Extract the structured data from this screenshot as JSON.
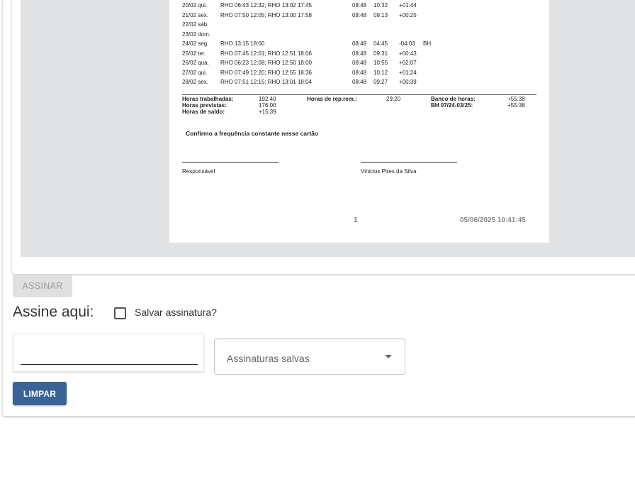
{
  "timesheet": {
    "rows": [
      {
        "date": "20/02 qui.",
        "marks": "RHO 06:43 12:32; RHO 13:02 17:45",
        "prev": "08:48",
        "work": "10:32",
        "diff": "+01:44",
        "note": ""
      },
      {
        "date": "21/02 sex.",
        "marks": "RHO 07:50 12:05; RHO 13:00 17:58",
        "prev": "08:48",
        "work": "09:13",
        "diff": "+00:25",
        "note": ""
      },
      {
        "date": "22/02 sáb.",
        "marks": "",
        "prev": "",
        "work": "",
        "diff": "",
        "note": ""
      },
      {
        "date": "23/02 dom.",
        "marks": "",
        "prev": "",
        "work": "",
        "diff": "",
        "note": ""
      },
      {
        "date": "24/02 seg.",
        "marks": "RHO 13:15 18:00",
        "prev": "08:48",
        "work": "04:45",
        "diff": "-04:03",
        "note": "BH"
      },
      {
        "date": "25/02 ter.",
        "marks": "RHO 07:45 12:01; RHO 12:51 18:06",
        "prev": "08:48",
        "work": "09:31",
        "diff": "+00:43",
        "note": ""
      },
      {
        "date": "26/02 qua.",
        "marks": "RHO 06:23 12:08; RHO 12:50 18:00",
        "prev": "08:48",
        "work": "10:55",
        "diff": "+02:07",
        "note": ""
      },
      {
        "date": "27/02 qui.",
        "marks": "RHO 07:49 12:20; RHO 12:55 18:36",
        "prev": "08:48",
        "work": "10:12",
        "diff": "+01:24",
        "note": ""
      },
      {
        "date": "28/02 sex.",
        "marks": "RHO 07:51 12:15; RHO 13:01 18:04",
        "prev": "08:48",
        "work": "09:27",
        "diff": "+00:39",
        "note": ""
      }
    ],
    "summary": {
      "worked_label": "Horas trabalhadas:",
      "worked_value": "192:40",
      "expected_label": "Horas previstas:",
      "expected_value": "176:00",
      "balance_label": "Horas de saldo:",
      "balance_value": "+15:39",
      "rest_label": "Horas de rep.rem.:",
      "rest_value": "29:20",
      "bank_label": "Banco de horas:",
      "bank_value": "+55:38",
      "bh_label": "BH 07/24-03/25:",
      "bh_value": "+55:38"
    },
    "confirm_text": "Confirmo a frequência constante nesse cartão",
    "signer_left": "Responsável",
    "signer_right": "Vinicius Pires da Silva",
    "page_number": "1",
    "printed_at": "05/06/2025 10:41:45"
  },
  "controls": {
    "sign_button": "ASSINAR",
    "sign_here": "Assine aqui:",
    "save_signature": "Salvar assinatura?",
    "saved_signatures": "Assinaturas salvas",
    "clear_button": "LIMPAR"
  }
}
